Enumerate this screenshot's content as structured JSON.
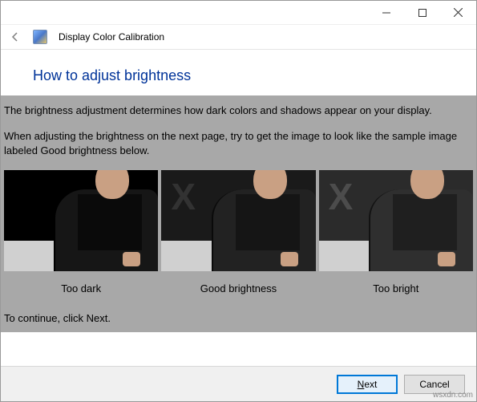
{
  "app": {
    "title": "Display Color Calibration"
  },
  "page": {
    "heading": "How to adjust brightness",
    "para1": "The brightness adjustment determines how dark colors and shadows appear on your display.",
    "para2": "When adjusting the brightness on the next page, try to get the image to look like the sample image labeled Good brightness below.",
    "continue": "To continue, click Next."
  },
  "examples": [
    {
      "caption": "Too dark"
    },
    {
      "caption": "Good brightness"
    },
    {
      "caption": "Too bright"
    }
  ],
  "buttons": {
    "next_u": "N",
    "next_rest": "ext",
    "cancel": "Cancel"
  },
  "watermark": "wsxdn.com"
}
